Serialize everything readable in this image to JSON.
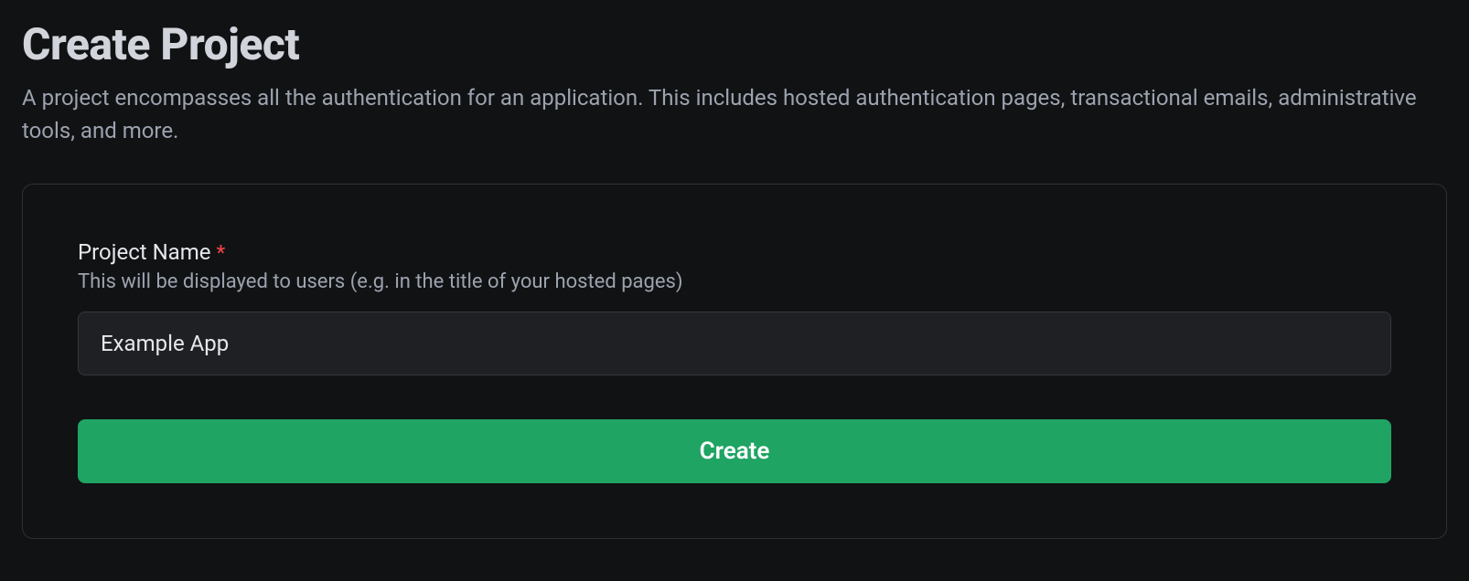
{
  "header": {
    "title": "Create Project",
    "subtitle": "A project encompasses all the authentication for an application. This includes hosted authentication pages, transactional emails, administrative tools, and more."
  },
  "form": {
    "project_name": {
      "label": "Project Name",
      "required_marker": "*",
      "help": "This will be displayed to users (e.g. in the title of your hosted pages)",
      "value": "Example App",
      "placeholder": ""
    },
    "submit_label": "Create"
  }
}
